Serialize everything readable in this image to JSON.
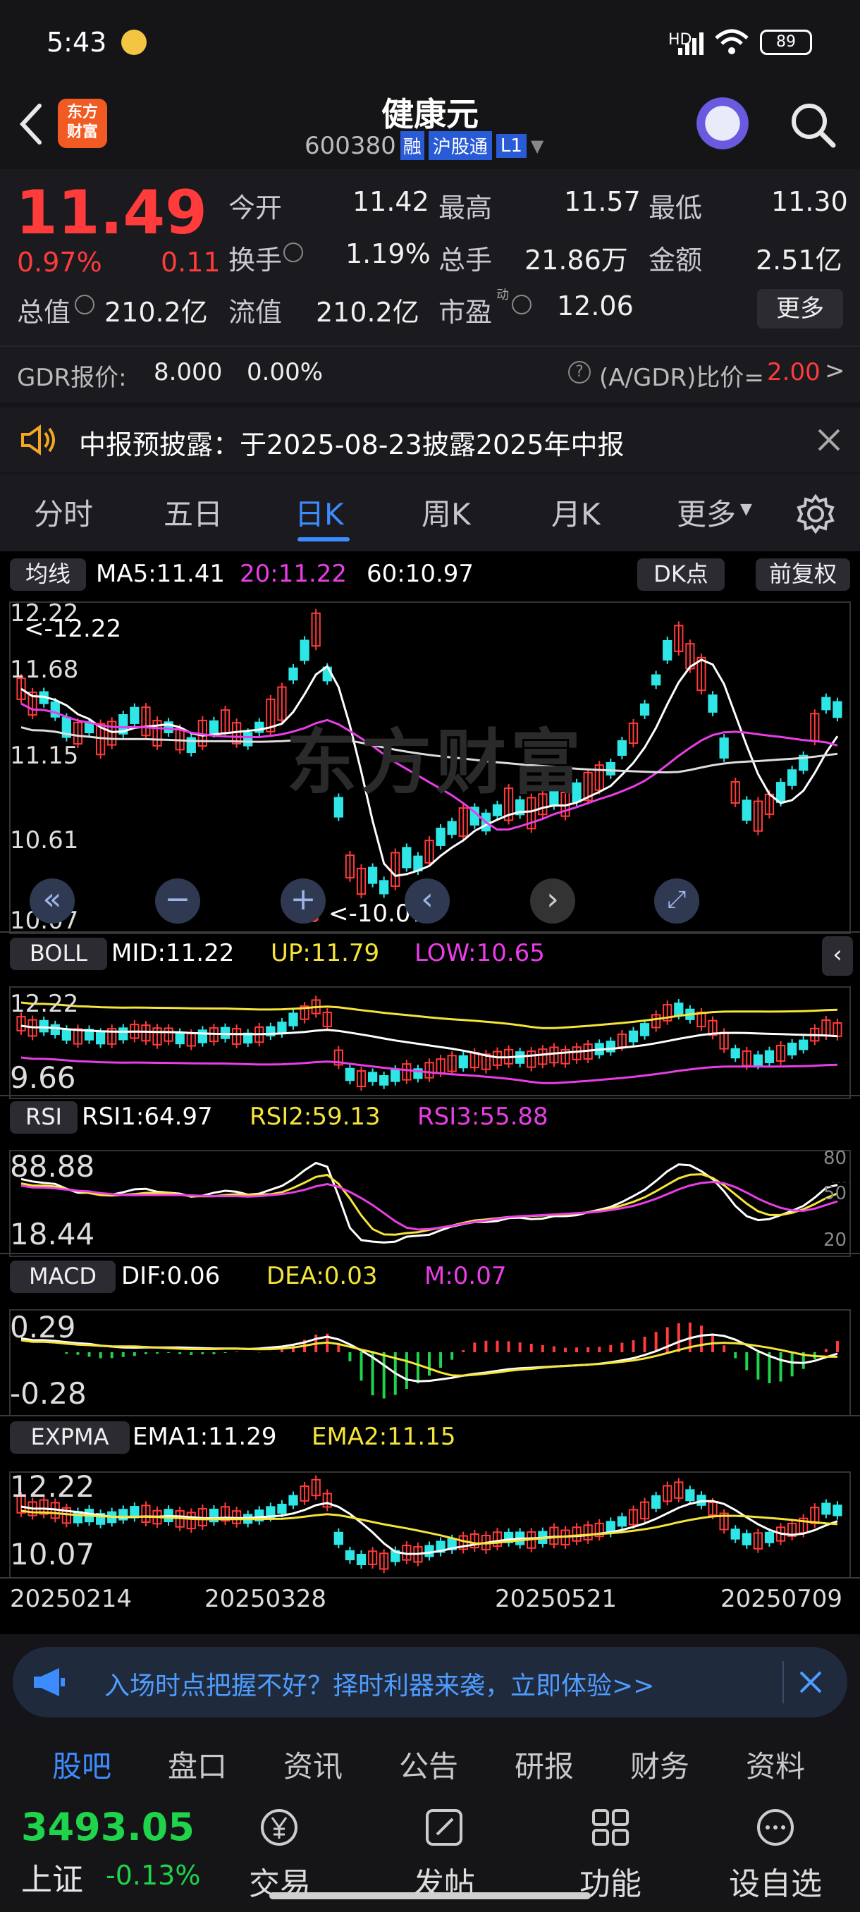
{
  "status": {
    "time": "5:43",
    "battery": "89",
    "net": "HD"
  },
  "header": {
    "title": "健康元",
    "code": "600380",
    "tag_rong": "融",
    "tag_hgt": "沪股通",
    "tag_l1": "L1",
    "logo_line1": "东方",
    "logo_line2": "财富"
  },
  "quote": {
    "price": "11.49",
    "pct": "0.97%",
    "chg": "0.11",
    "open_label": "今开",
    "open": "11.42",
    "high_label": "最高",
    "high": "11.57",
    "low_label": "最低",
    "low": "11.30",
    "turnover_label": "换手",
    "turnover": "1.19%",
    "volume_label": "总手",
    "volume": "21.86万",
    "amount_label": "金额",
    "amount": "2.51亿",
    "mcap_label": "总值",
    "mcap": "210.2亿",
    "float_label": "流值",
    "float": "210.2亿",
    "pe_label": "市盈",
    "pe_sup": "动",
    "pe": "12.06",
    "more": "更多",
    "gdr_label": "GDR报价:",
    "gdr_price": "8.000",
    "gdr_pct": "0.00%",
    "ratio_label": "(A/GDR)比价=",
    "ratio": "2.00"
  },
  "notice": {
    "text": "中报预披露：于2025-08-23披露2025年中报"
  },
  "tabs": [
    "分时",
    "五日",
    "日K",
    "周K",
    "月K",
    "更多"
  ],
  "chart": {
    "ma": {
      "label": "均线",
      "ma5": "MA5:11.41",
      "ma20": "20:11.22",
      "ma60": "60:10.97",
      "dk": "DK点",
      "fq": "前复权",
      "ticks": [
        "12.22",
        "11.68",
        "11.15",
        "10.61",
        "10.07"
      ],
      "max_label": "<-12.22",
      "min_label": "<-10.07",
      "watermark": "东方财富"
    },
    "boll": {
      "label": "BOLL",
      "mid": "MID:11.22",
      "up": "UP:11.79",
      "low": "LOW:10.65",
      "ticks": [
        "12.22",
        "9.66"
      ]
    },
    "rsi": {
      "label": "RSI",
      "rsi1": "RSI1:64.97",
      "rsi2": "RSI2:59.13",
      "rsi3": "RSI3:55.88",
      "ticks": [
        "88.88",
        "18.44"
      ],
      "levels": [
        "80",
        "50",
        "20"
      ]
    },
    "macd": {
      "label": "MACD",
      "dif": "DIF:0.06",
      "dea": "DEA:0.03",
      "m": "M:0.07",
      "ticks": [
        "0.29",
        "-0.28"
      ]
    },
    "expma": {
      "label": "EXPMA",
      "ema1": "EMA1:11.29",
      "ema2": "EMA2:11.15",
      "ticks": [
        "12.22",
        "10.07"
      ]
    },
    "dates": [
      "20250214",
      "20250328",
      "20250521",
      "20250709"
    ]
  },
  "banner": {
    "text": "入场时点把握不好？择时利器来袭，立即体验>>"
  },
  "bottom_tabs": [
    "股吧",
    "盘口",
    "资讯",
    "公告",
    "研报",
    "财务",
    "资料"
  ],
  "dock": {
    "index_value": "3493.05",
    "index_name": "上证",
    "index_pct": "-0.13%",
    "items": [
      "交易",
      "发帖",
      "功能",
      "设自选"
    ]
  },
  "colors": {
    "up": "#ff3b3b",
    "down": "#1fd34a",
    "accent": "#3d8cff"
  }
}
